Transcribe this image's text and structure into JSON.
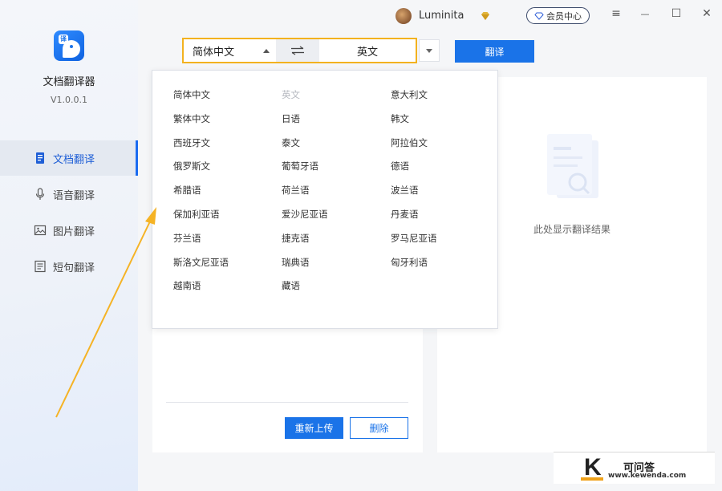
{
  "app": {
    "name": "文档翻译器",
    "version": "V1.0.0.1",
    "logo_badge": "译"
  },
  "sidebar": {
    "items": [
      {
        "label": "文档翻译",
        "icon": "document-icon",
        "active": true
      },
      {
        "label": "语音翻译",
        "icon": "microphone-icon",
        "active": false
      },
      {
        "label": "图片翻译",
        "icon": "image-icon",
        "active": false
      },
      {
        "label": "短句翻译",
        "icon": "text-lines-icon",
        "active": false
      }
    ]
  },
  "titlebar": {
    "username": "Luminita",
    "member_center": "会员中心",
    "controls": {
      "menu": "≡",
      "minimize": "—",
      "maximize": "☐",
      "close": "✕"
    }
  },
  "toolbar": {
    "source_lang": "简体中文",
    "target_lang": "英文",
    "translate": "翻译"
  },
  "upload": {
    "reupload": "重新上传",
    "delete": "删除"
  },
  "result": {
    "placeholder": "此处显示翻译结果"
  },
  "language_menu": {
    "columns": [
      [
        "简体中文",
        "繁体中文",
        "西班牙文",
        "俄罗斯文",
        "希腊语",
        "保加利亚语",
        "芬兰语",
        "斯洛文尼亚语",
        "越南语"
      ],
      [
        "英文",
        "日语",
        "泰文",
        "葡萄牙语",
        "荷兰语",
        "爱沙尼亚语",
        "捷克语",
        "瑞典语",
        "藏语"
      ],
      [
        "意大利文",
        "韩文",
        "阿拉伯文",
        "德语",
        "波兰语",
        "丹麦语",
        "罗马尼亚语",
        "匈牙利语"
      ]
    ],
    "disabled": [
      "英文"
    ]
  },
  "watermark": {
    "letter": "K",
    "site_cn": "可问答",
    "site_url": "www.kewenda.com"
  },
  "colors": {
    "accent": "#1a73e8",
    "highlight": "#f3b21f",
    "arrow": "#f5b325"
  }
}
